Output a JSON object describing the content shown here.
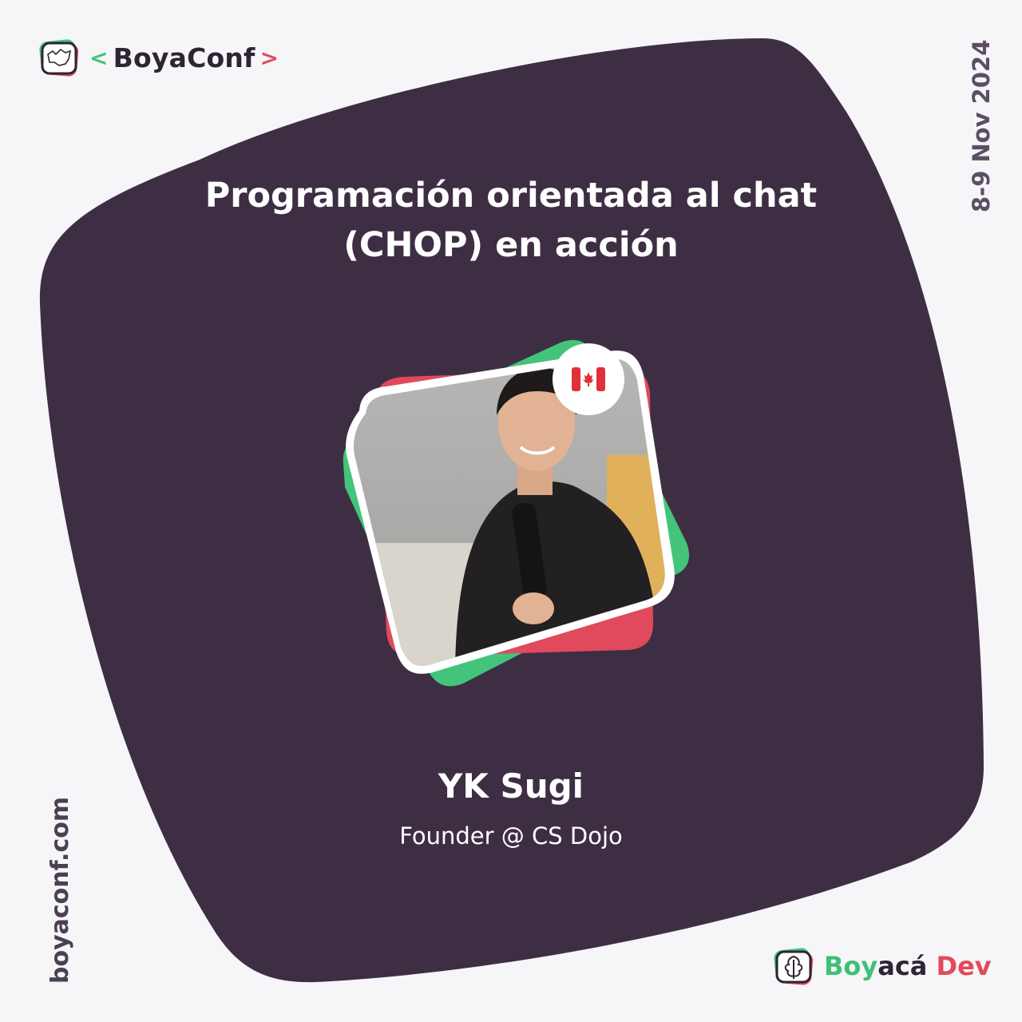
{
  "colors": {
    "background": "#f6f5f8",
    "blob": "#3e2e44",
    "accent_green": "#43c47a",
    "accent_red": "#e14a5c",
    "text_light": "#ffffff",
    "text_dark": "#2e2434"
  },
  "header": {
    "brand_left": "<",
    "brand_name": "BoyaConf",
    "brand_right": ">",
    "brand_icon": "map-icon"
  },
  "event": {
    "date": "8-9 Nov 2024",
    "website": "boyaconf.com"
  },
  "talk": {
    "title_line1": "Programación orientada al chat",
    "title_line2": "(CHOP) en acción"
  },
  "speaker": {
    "name": "YK Sugi",
    "role": "Founder @ CS Dojo",
    "country_flag": "canada-flag-icon",
    "photo_subject": "speaker-photo"
  },
  "footer": {
    "brand_part1": "Boy",
    "brand_part2": "acá",
    "brand_part3": " Dev",
    "brand_icon": "oak-leaf-icon"
  }
}
